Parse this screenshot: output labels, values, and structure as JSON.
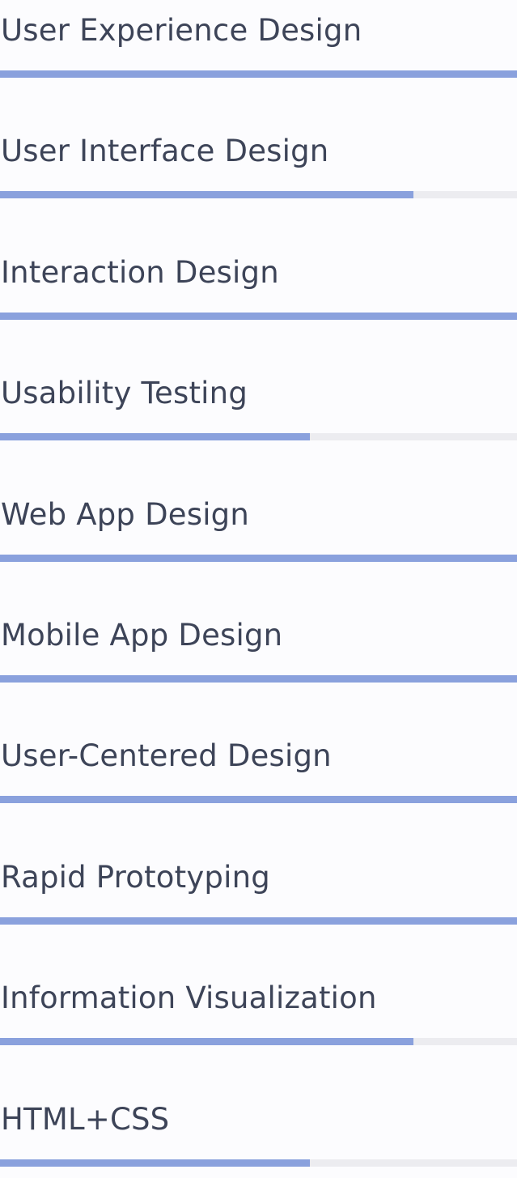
{
  "colors": {
    "bar_fill": "#8aa1dd",
    "bar_track": "#ececf0",
    "text": "#3d4458",
    "background": "#fcfcfe"
  },
  "skills": [
    {
      "label": "User Experience Design",
      "level": 1.0
    },
    {
      "label": "User Interface Design",
      "level": 0.8
    },
    {
      "label": "Interaction Design",
      "level": 1.0
    },
    {
      "label": "Usability Testing",
      "level": 0.6
    },
    {
      "label": "Web App Design",
      "level": 1.0
    },
    {
      "label": "Mobile App Design",
      "level": 1.0
    },
    {
      "label": "User-Centered Design",
      "level": 1.0
    },
    {
      "label": "Rapid Prototyping",
      "level": 1.0
    },
    {
      "label": "Information Visualization",
      "level": 0.8
    },
    {
      "label": "HTML+CSS",
      "level": 0.6
    }
  ]
}
